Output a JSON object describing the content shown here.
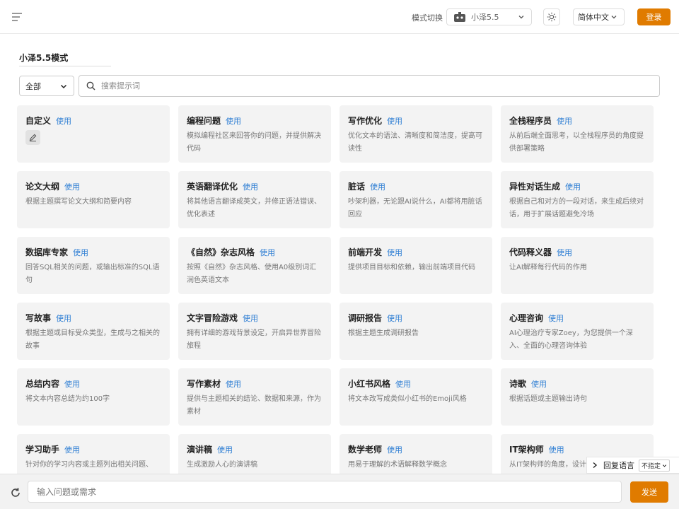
{
  "header": {
    "mode_label": "模式切换",
    "model_name": "小泽5.5",
    "language": "简体中文",
    "login_label": "登录"
  },
  "mode_title": "小泽5.5模式",
  "filter": {
    "category": "全部",
    "search_placeholder": "搜索提示词"
  },
  "use_label": "使用",
  "cards": [
    {
      "title": "自定义",
      "desc": ""
    },
    {
      "title": "编程问题",
      "desc": "模拟编程社区来回答你的问题，并提供解决代码"
    },
    {
      "title": "写作优化",
      "desc": "优化文本的语法、清晰度和简洁度，提高可读性"
    },
    {
      "title": "全栈程序员",
      "desc": "从前后端全面思考，以全栈程序员的角度提供部署策略"
    },
    {
      "title": "论文大纲",
      "desc": "根据主题撰写论文大纲和简要内容"
    },
    {
      "title": "英语翻译优化",
      "desc": "将其他语言翻译成英文，并修正语法错误、优化表述"
    },
    {
      "title": "脏话",
      "desc": "吵架利器，无论跟AI说什么，AI都将用脏话回应"
    },
    {
      "title": "异性对话生成",
      "desc": "根据自己和对方的一段对话，来生成后续对话，用于扩展话题避免冷场"
    },
    {
      "title": "数据库专家",
      "desc": "回答SQL相关的问题，或输出标准的SQL语句"
    },
    {
      "title": "《自然》杂志风格",
      "desc": "按照《自然》杂志风格、使用A0级别词汇润色英语文本"
    },
    {
      "title": "前端开发",
      "desc": "提供项目目标和依赖，输出前端项目代码"
    },
    {
      "title": "代码释义器",
      "desc": "让AI解释每行代码的作用"
    },
    {
      "title": "写故事",
      "desc": "根据主题或目标受众类型，生成与之相关的故事"
    },
    {
      "title": "文字冒险游戏",
      "desc": "拥有详细的游戏背景设定，开启异世界冒险旅程"
    },
    {
      "title": "调研报告",
      "desc": "根据主题生成调研报告"
    },
    {
      "title": "心理咨询",
      "desc": "AI心理治疗专家Zoey，为您提供一个深入、全面的心理咨询体验"
    },
    {
      "title": "总结内容",
      "desc": "将文本内容总结为约100字"
    },
    {
      "title": "写作素材",
      "desc": "提供与主题相关的结论、数据和来源，作为素材"
    },
    {
      "title": "小红书风格",
      "desc": "将文本改写成类似小红书的Emoji风格"
    },
    {
      "title": "诗歌",
      "desc": "根据话题或主题输出诗句"
    },
    {
      "title": "学习助手",
      "desc": "针对你的学习内容或主题列出相关问题、"
    },
    {
      "title": "演讲稿",
      "desc": "生成激励人心的演讲稿"
    },
    {
      "title": "数学老师",
      "desc": "用易于理解的术语解释数学概念"
    },
    {
      "title": "IT架构师",
      "desc": "从IT架构师的角度，设计"
    }
  ],
  "reply_language": {
    "label": "回复语言",
    "value": "不指定"
  },
  "chat": {
    "placeholder": "输入问题或需求",
    "send_label": "发送"
  },
  "colors": {
    "accent": "#e07b00",
    "link": "#2f7fd4",
    "card_bg": "#f3f3f3"
  }
}
